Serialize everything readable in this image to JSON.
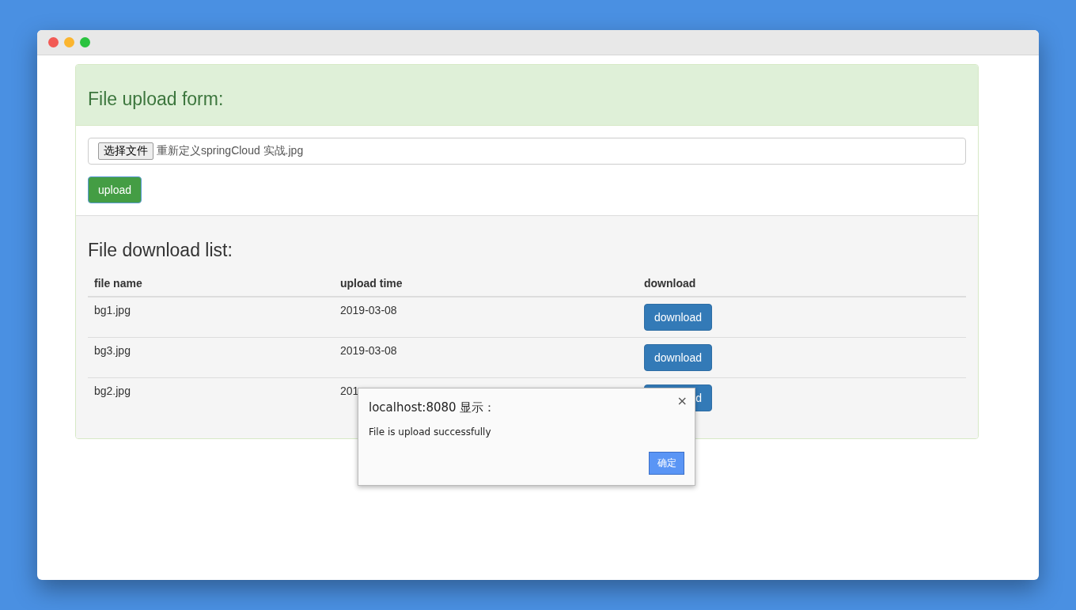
{
  "upload_panel": {
    "title": "File upload form:",
    "file_button": "选择文件",
    "file_name": "重新定义springCloud 实战.jpg",
    "upload_button": "upload"
  },
  "download_panel": {
    "title": "File download list:",
    "columns": [
      "file name",
      "upload time",
      "download"
    ],
    "rows": [
      {
        "file_name": "bg1.jpg",
        "upload_time": "2019-03-08",
        "button": "download"
      },
      {
        "file_name": "bg3.jpg",
        "upload_time": "2019-03-08",
        "button": "download"
      },
      {
        "file_name": "bg2.jpg",
        "upload_time": "201",
        "button": "d"
      }
    ]
  },
  "dialog": {
    "title": "localhost:8080 显示：",
    "close": "×",
    "message": "File is upload successfully",
    "ok_button": "确定"
  }
}
